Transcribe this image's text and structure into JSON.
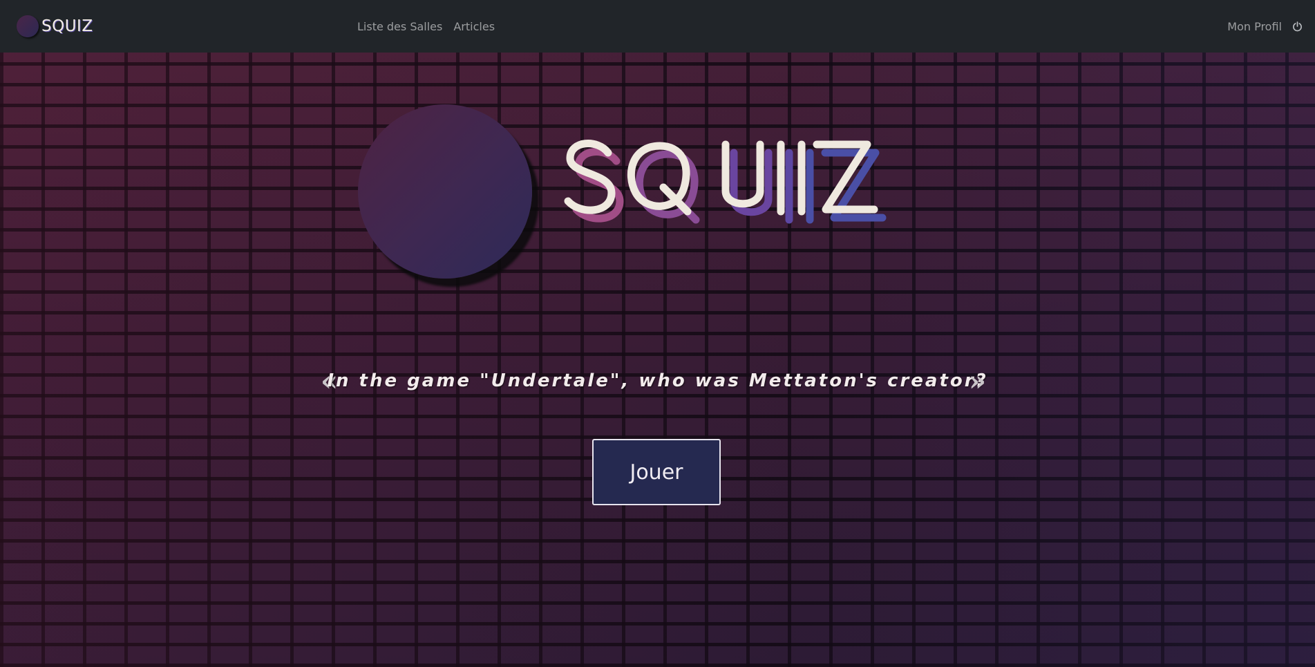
{
  "navbar": {
    "brand_text": "SQUIZ",
    "links": [
      "Liste des Salles",
      "Articles"
    ],
    "profile_label": "Mon Profil"
  },
  "hero": {
    "logo_text": "SQUIZ",
    "quote": "In the game \"Undertale\", who was Mettaton's creator?",
    "prev_label": "«",
    "next_label": "»",
    "play_label": "Jouer"
  },
  "icons": {
    "power": "power-icon",
    "logo_ball": "circle"
  },
  "colors": {
    "navbar_bg": "#212529",
    "button_bg": "#252950",
    "logo_pink": "#a14d86",
    "logo_purple": "#6a45a0",
    "logo_blue": "#4a4fa6",
    "logo_cream": "#efe9df"
  }
}
